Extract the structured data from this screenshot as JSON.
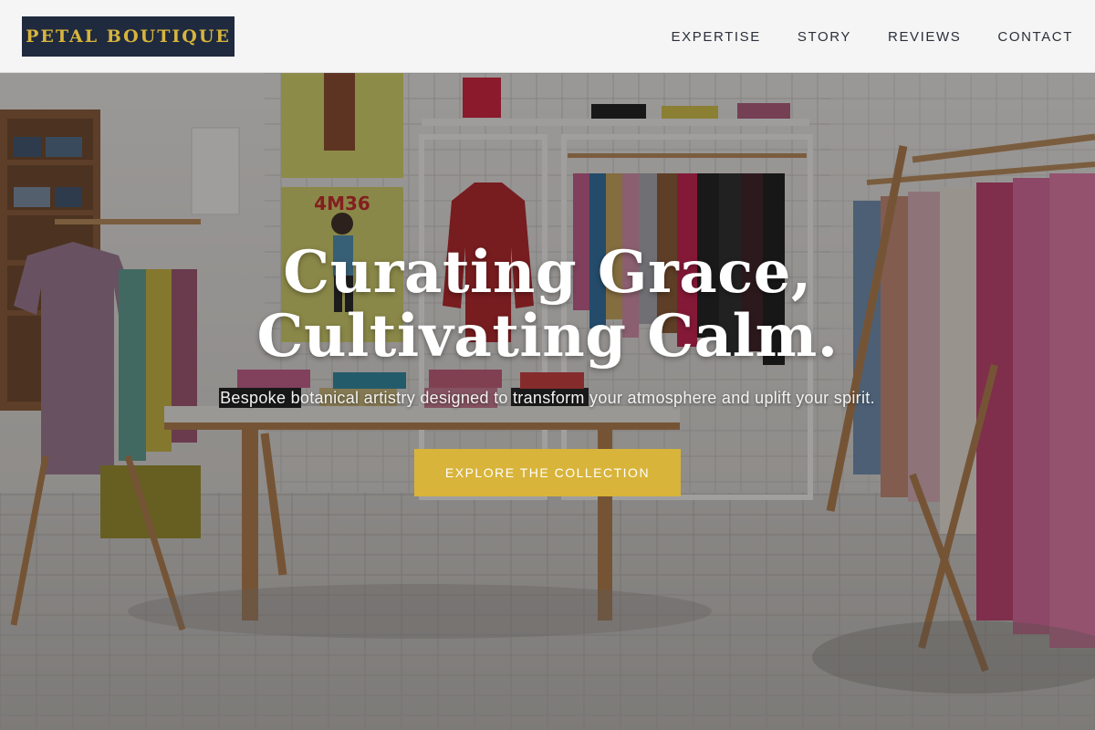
{
  "header": {
    "brand": "PETAL BOUTIQUE",
    "nav": [
      {
        "label": "EXPERTISE"
      },
      {
        "label": "STORY"
      },
      {
        "label": "REVIEWS"
      },
      {
        "label": "CONTACT"
      }
    ]
  },
  "hero": {
    "headline_line1": "Curating Grace,",
    "headline_line2": "Cultivating Calm.",
    "subtitle": "Bespoke botanical artistry designed to transform your atmosphere and uplift your spirit.",
    "cta_label": "EXPLORE THE COLLECTION",
    "poster_text": "4M36"
  },
  "colors": {
    "brand_bg": "#1f2a3e",
    "brand_text": "#d8b43c",
    "cta_bg": "#d8b43a",
    "nav_text": "#2b2f3a"
  }
}
